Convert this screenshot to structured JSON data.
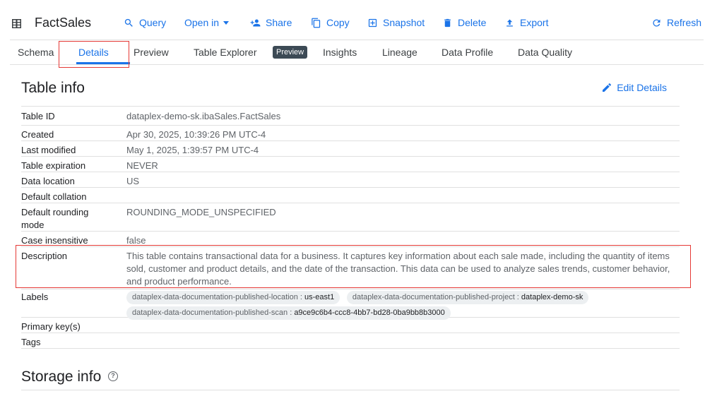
{
  "toolbar": {
    "title": "FactSales",
    "query": "Query",
    "open_in": "Open in",
    "share": "Share",
    "copy": "Copy",
    "snapshot": "Snapshot",
    "delete": "Delete",
    "export": "Export",
    "refresh": "Refresh"
  },
  "tabs": {
    "schema": "Schema",
    "details": "Details",
    "preview": "Preview",
    "table_explorer": "Table Explorer",
    "table_explorer_badge": "Preview",
    "insights": "Insights",
    "lineage": "Lineage",
    "data_profile": "Data Profile",
    "data_quality": "Data Quality"
  },
  "table_info": {
    "title": "Table info",
    "edit": "Edit Details",
    "rows": [
      {
        "key": "Table ID",
        "value": "dataplex-demo-sk.ibaSales.FactSales"
      },
      {
        "key": "Created",
        "value": "Apr 30, 2025, 10:39:26 PM UTC-4"
      },
      {
        "key": "Last modified",
        "value": "May 1, 2025, 1:39:57 PM UTC-4"
      },
      {
        "key": "Table expiration",
        "value": "NEVER"
      },
      {
        "key": "Data location",
        "value": "US"
      },
      {
        "key": "Default collation",
        "value": ""
      },
      {
        "key": "Default rounding mode",
        "value": "ROUNDING_MODE_UNSPECIFIED"
      },
      {
        "key": "Case insensitive",
        "value": "false"
      },
      {
        "key": "Description",
        "value": "This table contains transactional data for a business. It captures key information about each sale made, including the quantity of items sold, customer and product details, and the date of the transaction. This data can be used to analyze sales trends, customer behavior, and product performance."
      }
    ],
    "labels_key": "Labels",
    "labels": [
      {
        "key": "dataplex-data-documentation-published-location",
        "value": "us-east1"
      },
      {
        "key": "dataplex-data-documentation-published-project",
        "value": "dataplex-demo-sk"
      },
      {
        "key": "dataplex-data-documentation-published-scan",
        "value": "a9ce9c6b4-ccc8-4bb7-bd28-0ba9bb8b3000"
      }
    ],
    "primary_keys_key": "Primary key(s)",
    "tags_key": "Tags"
  },
  "storage_info": {
    "title": "Storage info"
  }
}
